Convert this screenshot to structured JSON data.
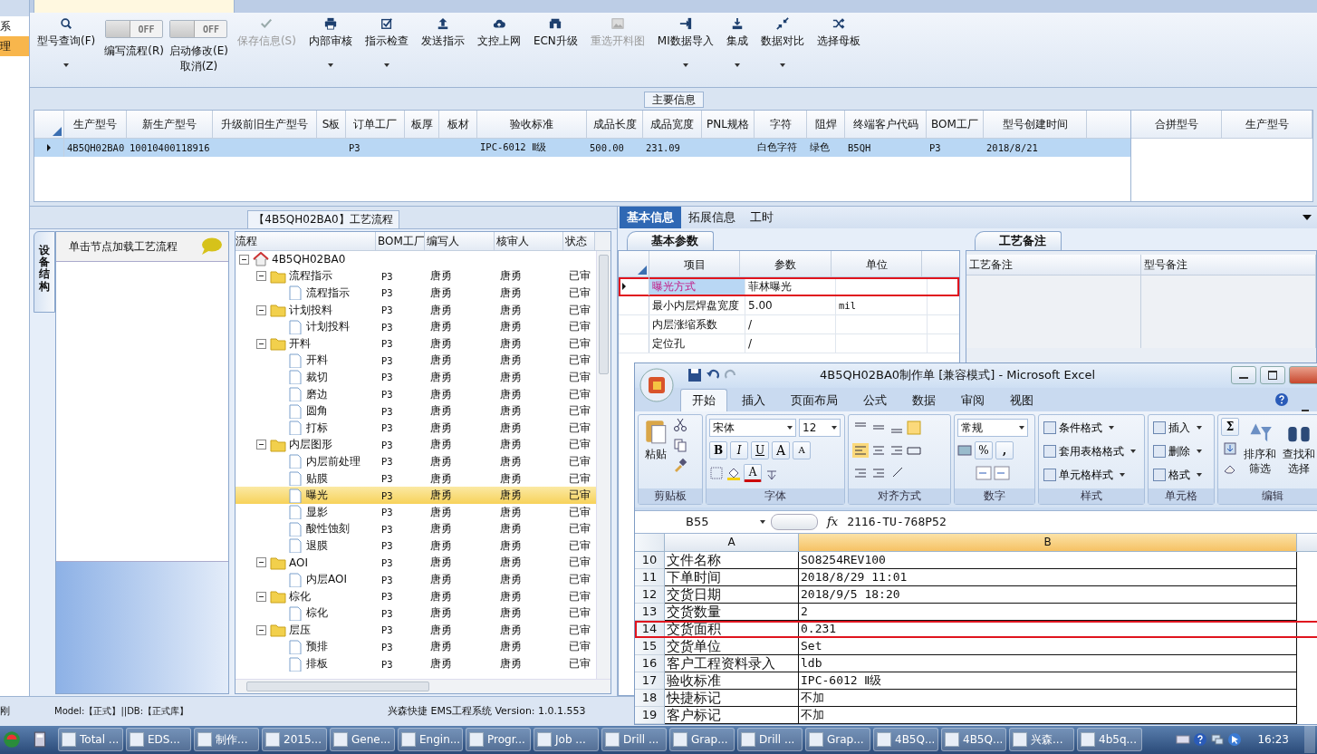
{
  "side_nav": {
    "items": [
      {
        "label": "系",
        "selected": false
      },
      {
        "label": "理",
        "selected": true
      }
    ]
  },
  "toolbar": {
    "items": [
      {
        "kind": "button",
        "label": "型号查询(F)",
        "disabled": false,
        "dropdown": true
      },
      {
        "kind": "toggle",
        "label": "编写流程(R)",
        "state": "OFF",
        "on": false
      },
      {
        "kind": "toggle",
        "label": "启动修改(E)\n取消(Z)",
        "state": "OFF",
        "on": false
      },
      {
        "kind": "button",
        "label": "保存信息(S)",
        "disabled": true,
        "dropdown": false
      },
      {
        "kind": "button",
        "label": "内部审核",
        "disabled": false,
        "dropdown": true
      },
      {
        "kind": "button",
        "label": "指示检查",
        "disabled": false,
        "dropdown": true
      },
      {
        "kind": "button",
        "label": "发送指示",
        "disabled": false,
        "dropdown": false
      },
      {
        "kind": "button",
        "label": "文控上网",
        "disabled": false,
        "dropdown": false
      },
      {
        "kind": "button",
        "label": "ECN升级",
        "disabled": false,
        "dropdown": false
      },
      {
        "kind": "button",
        "label": "重选开料图",
        "disabled": true,
        "dropdown": false
      },
      {
        "kind": "button",
        "label": "MI数据导入",
        "disabled": false,
        "dropdown": true
      },
      {
        "kind": "button",
        "label": "集成",
        "disabled": false,
        "dropdown": true
      },
      {
        "kind": "button",
        "label": "数据对比",
        "disabled": false,
        "dropdown": true
      },
      {
        "kind": "button",
        "label": "选择母板",
        "disabled": false,
        "dropdown": false
      }
    ]
  },
  "main_info": {
    "title": "主要信息",
    "columns": [
      "生产型号",
      "新生产型号",
      "升级前旧生产型号",
      "S板",
      "订单工厂",
      "板厚",
      "板材",
      "验收标准",
      "成品长度",
      "成品宽度",
      "PNL规格",
      "字符",
      "阻焊",
      "终端客户代码",
      "BOM工厂",
      "型号创建时间"
    ],
    "rows": [
      {
        "selected": true,
        "cells": [
          "4B5QH02BA0",
          "10010400118916",
          null,
          null,
          "P3",
          null,
          null,
          "IPC-6012 Ⅱ级",
          "500.00",
          "231.09",
          null,
          "白色字符",
          "绿色",
          "B5QH",
          "P3",
          "2018/8/21"
        ]
      }
    ],
    "side_columns": [
      "合拼型号",
      "生产型号"
    ]
  },
  "process": {
    "title": "【4B5QH02BA0】工艺流程",
    "side_tab": "设备结构",
    "hint": "单击节点加载工艺流程",
    "columns": [
      "流程",
      "BOM工厂",
      "编写人",
      "核审人",
      "状态"
    ],
    "tree": {
      "label": "4B5QH02BA0",
      "expanded": true,
      "selected": false,
      "children": [
        {
          "label": "流程指示",
          "bom": "P3",
          "writer": "唐勇",
          "reviewer": "唐勇",
          "status": "已审",
          "expanded": true,
          "selected": false,
          "children": [
            {
              "label": "流程指示",
              "bom": "P3",
              "writer": "唐勇",
              "reviewer": "唐勇",
              "status": "已审",
              "selected": false
            }
          ]
        },
        {
          "label": "计划投料",
          "bom": "P3",
          "writer": "唐勇",
          "reviewer": "唐勇",
          "status": "已审",
          "expanded": true,
          "selected": false,
          "children": [
            {
              "label": "计划投料",
              "bom": "P3",
              "writer": "唐勇",
              "reviewer": "唐勇",
              "status": "已审",
              "selected": false
            }
          ]
        },
        {
          "label": "开料",
          "bom": "P3",
          "writer": "唐勇",
          "reviewer": "唐勇",
          "status": "已审",
          "expanded": true,
          "selected": false,
          "children": [
            {
              "label": "开料",
              "bom": "P3",
              "writer": "唐勇",
              "reviewer": "唐勇",
              "status": "已审",
              "selected": false
            },
            {
              "label": "裁切",
              "bom": "P3",
              "writer": "唐勇",
              "reviewer": "唐勇",
              "status": "已审",
              "selected": false
            },
            {
              "label": "磨边",
              "bom": "P3",
              "writer": "唐勇",
              "reviewer": "唐勇",
              "status": "已审",
              "selected": false
            },
            {
              "label": "圆角",
              "bom": "P3",
              "writer": "唐勇",
              "reviewer": "唐勇",
              "status": "已审",
              "selected": false
            },
            {
              "label": "打标",
              "bom": "P3",
              "writer": "唐勇",
              "reviewer": "唐勇",
              "status": "已审",
              "selected": false
            }
          ]
        },
        {
          "label": "内层图形",
          "bom": "P3",
          "writer": "唐勇",
          "reviewer": "唐勇",
          "status": "已审",
          "expanded": true,
          "selected": false,
          "children": [
            {
              "label": "内层前处理",
              "bom": "P3",
              "writer": "唐勇",
              "reviewer": "唐勇",
              "status": "已审",
              "selected": false
            },
            {
              "label": "贴膜",
              "bom": "P3",
              "writer": "唐勇",
              "reviewer": "唐勇",
              "status": "已审",
              "selected": false
            },
            {
              "label": "曝光",
              "bom": "P3",
              "writer": "唐勇",
              "reviewer": "唐勇",
              "status": "已审",
              "selected": true
            },
            {
              "label": "显影",
              "bom": "P3",
              "writer": "唐勇",
              "reviewer": "唐勇",
              "status": "已审",
              "selected": false
            },
            {
              "label": "酸性蚀刻",
              "bom": "P3",
              "writer": "唐勇",
              "reviewer": "唐勇",
              "status": "已审",
              "selected": false
            },
            {
              "label": "退膜",
              "bom": "P3",
              "writer": "唐勇",
              "reviewer": "唐勇",
              "status": "已审",
              "selected": false
            }
          ]
        },
        {
          "label": "AOI",
          "bom": "P3",
          "writer": "唐勇",
          "reviewer": "唐勇",
          "status": "已审",
          "expanded": true,
          "selected": false,
          "children": [
            {
              "label": "内层AOI",
              "bom": "P3",
              "writer": "唐勇",
              "reviewer": "唐勇",
              "status": "已审",
              "selected": false
            }
          ]
        },
        {
          "label": "棕化",
          "bom": "P3",
          "writer": "唐勇",
          "reviewer": "唐勇",
          "status": "已审",
          "expanded": true,
          "selected": false,
          "children": [
            {
              "label": "棕化",
              "bom": "P3",
              "writer": "唐勇",
              "reviewer": "唐勇",
              "status": "已审",
              "selected": false
            }
          ]
        },
        {
          "label": "层压",
          "bom": "P3",
          "writer": "唐勇",
          "reviewer": "唐勇",
          "status": "已审",
          "expanded": true,
          "selected": false,
          "children": [
            {
              "label": "预排",
              "bom": "P3",
              "writer": "唐勇",
              "reviewer": "唐勇",
              "status": "已审",
              "selected": false
            },
            {
              "label": "排板",
              "bom": "P3",
              "writer": "唐勇",
              "reviewer": "唐勇",
              "status": "已审",
              "selected": false
            }
          ]
        }
      ]
    }
  },
  "detail": {
    "tabs": [
      {
        "label": "基本信息",
        "selected": true
      },
      {
        "label": "拓展信息",
        "selected": false
      },
      {
        "label": "工时",
        "selected": false
      }
    ],
    "params": {
      "tab": "基本参数",
      "columns": [
        "项目",
        "参数",
        "单位"
      ],
      "rows": [
        {
          "item": "曝光方式",
          "value": "菲林曝光",
          "selected": true,
          "highlighted": true
        },
        {
          "item": "最小内层焊盘宽度",
          "value": "5.00",
          "unit": "mil",
          "selected": false,
          "highlighted": false
        },
        {
          "item": "内层涨缩系数",
          "value": "/",
          "selected": false,
          "highlighted": false
        },
        {
          "item": "定位孔",
          "value": "/",
          "selected": false,
          "highlighted": false
        }
      ]
    },
    "notes": {
      "tab": "工艺备注",
      "columns": [
        "工艺备注",
        "型号备注"
      ]
    }
  },
  "excel": {
    "title": "4B5QH02BA0制作单  [兼容模式] - Microsoft Excel",
    "tabs": [
      {
        "label": "开始",
        "selected": true
      },
      {
        "label": "插入",
        "selected": false
      },
      {
        "label": "页面布局",
        "selected": false
      },
      {
        "label": "公式",
        "selected": false
      },
      {
        "label": "数据",
        "selected": false
      },
      {
        "label": "审阅",
        "selected": false
      },
      {
        "label": "视图",
        "selected": false
      }
    ],
    "ribbon": {
      "paste": "粘贴",
      "font": "宋体",
      "size": "12",
      "bold": "B",
      "italic": "I",
      "underline": "U",
      "grow": "A",
      "shrink": "A",
      "font_color_letter": "A",
      "number_format": "常规",
      "percent": "%",
      "comma": ",",
      "styles": [
        "条件格式",
        "套用表格格式",
        "单元格样式"
      ],
      "cells": [
        "插入",
        "删除",
        "格式"
      ],
      "sum": "Σ",
      "sort": [
        "排序和",
        "筛选"
      ],
      "find": [
        "查找和",
        "选择"
      ],
      "groups": [
        "剪贴板",
        "字体",
        "对齐方式",
        "数字",
        "样式",
        "单元格",
        "编辑"
      ]
    },
    "name_box": "B55",
    "function_label": "fx",
    "formula": "2116-TU-768P52",
    "columns": [
      {
        "label": "A",
        "selected": false
      },
      {
        "label": "B",
        "selected": true
      }
    ],
    "rows": [
      {
        "num": "10",
        "a": "文件名称",
        "b": "SO8254REV100",
        "highlighted": false
      },
      {
        "num": "11",
        "a": "下单时间",
        "b": "2018/8/29 11:01",
        "highlighted": false
      },
      {
        "num": "12",
        "a": "交货日期",
        "b": "2018/9/5 18:20",
        "highlighted": false
      },
      {
        "num": "13",
        "a": "交货数量",
        "b": "2",
        "highlighted": false
      },
      {
        "num": "14",
        "a": "交货面积",
        "b": "0.231",
        "highlighted": true
      },
      {
        "num": "15",
        "a": "交货单位",
        "b": "Set",
        "highlighted": false
      },
      {
        "num": "16",
        "a": "客户工程资料录入",
        "b": "ldb",
        "highlighted": false
      },
      {
        "num": "17",
        "a": "验收标准",
        "b": "IPC-6012 Ⅱ级",
        "highlighted": false
      },
      {
        "num": "18",
        "a": "快捷标记",
        "b": "不加",
        "highlighted": false
      },
      {
        "num": "19",
        "a": "客户标记",
        "b": "不加",
        "highlighted": false
      }
    ]
  },
  "status_bar": {
    "left": "刚",
    "model": "Model:【正式】||DB:【正式库】",
    "version": "兴森快捷 EMS工程系统 Version: 1.0.1.553"
  },
  "taskbar": {
    "items": [
      "Total ...",
      "EDS...",
      "制作...",
      "2015...",
      "Gene...",
      "Engin...",
      "Progr...",
      "Job ...",
      "Drill ...",
      "Grap...",
      "Drill ...",
      "Grap...",
      "4B5Q...",
      "4B5Q...",
      "兴森...",
      "4b5q..."
    ],
    "time": "16:23"
  }
}
